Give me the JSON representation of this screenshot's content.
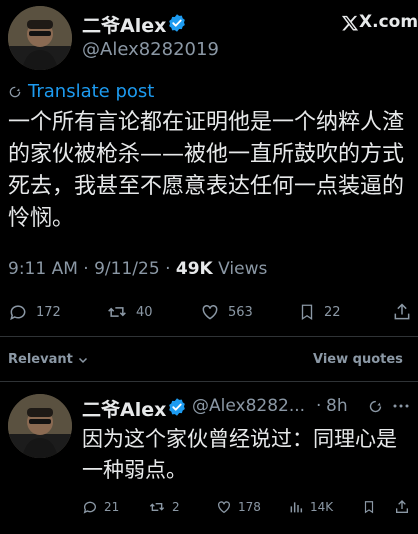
{
  "brand": "X.com",
  "colors": {
    "background": "#000000",
    "text": "#e7e9ea",
    "muted": "#8b98a5",
    "accent": "#1d9bf0",
    "verified": "#1d9bf0"
  },
  "post": {
    "author_name": "二爷Alex",
    "handle": "@Alex8282019",
    "translate_label": "Translate post",
    "text": "一个所有言论都在证明他是一个纳粹人渣的家伙被枪杀——被他一直所鼓吹的方式死去，我甚至不愿意表达任何一点装逼的怜悯。",
    "time": "9:11 AM",
    "date": "9/11/25",
    "views_count": "49K",
    "views_label": "Views",
    "actions": {
      "replies": "172",
      "reposts": "40",
      "likes": "563",
      "bookmarks": "22"
    }
  },
  "replies_bar": {
    "sort_label": "Relevant",
    "view_quotes_label": "View quotes"
  },
  "reply": {
    "author_name": "二爷Alex",
    "handle": "@Alex8282...",
    "time": "8h",
    "text": "因为这个家伙曾经说过：同理心是一种弱点。",
    "actions": {
      "replies": "21",
      "reposts": "2",
      "likes": "178",
      "views": "14K"
    }
  }
}
